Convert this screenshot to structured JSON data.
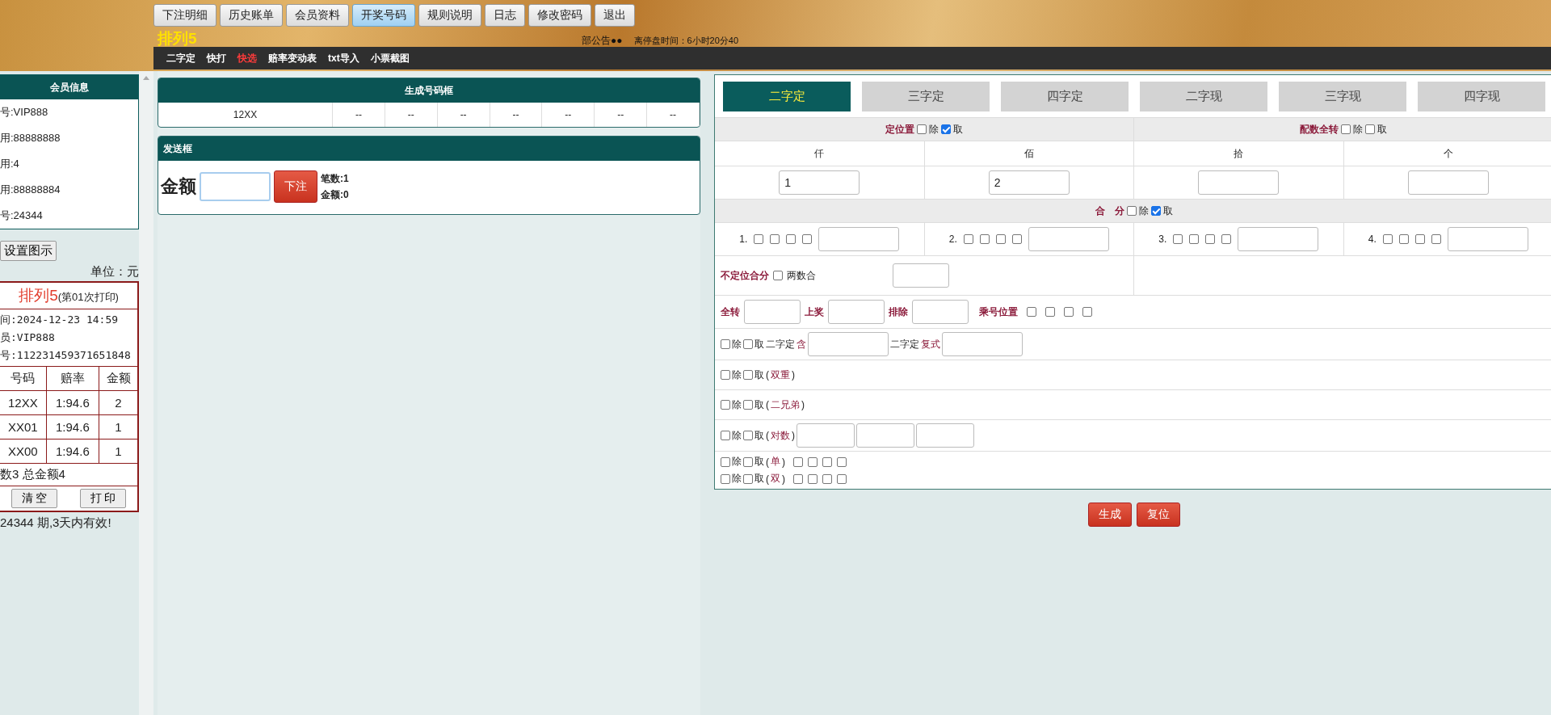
{
  "nav_buttons": [
    {
      "label": "下注明细",
      "selected": false
    },
    {
      "label": "历史账单",
      "selected": false
    },
    {
      "label": "会员资料",
      "selected": false
    },
    {
      "label": "开奖号码",
      "selected": true
    },
    {
      "label": "规则说明",
      "selected": false
    },
    {
      "label": "日志",
      "selected": false
    },
    {
      "label": "修改密码",
      "selected": false
    },
    {
      "label": "退出",
      "selected": false
    }
  ],
  "title": "排列5",
  "notice": "部公告●●",
  "countdown": "离停盘时间：6小时20分40",
  "subnav": [
    {
      "label": "二字定",
      "active": false
    },
    {
      "label": "快打",
      "active": false
    },
    {
      "label": "快选",
      "active": true
    },
    {
      "label": "赔率变动表",
      "active": false
    },
    {
      "label": "txt导入",
      "active": false
    },
    {
      "label": "小票截图",
      "active": false
    }
  ],
  "member_info": {
    "title": "会员信息",
    "lines": [
      "号:VIP888",
      "用:88888888",
      "用:4",
      "用:88888884",
      "号:24344"
    ]
  },
  "settings_button": "设置图示",
  "unit": "单位：元",
  "ticket": {
    "title": "排列5",
    "subtitle": "(第01次打印)",
    "lines": [
      "间:2024-12-23 14:59",
      "员:VIP888",
      "号:112231459371651848"
    ],
    "columns": [
      "号码",
      "赔率",
      "金额"
    ],
    "rows": [
      [
        "12XX",
        "1:94.6",
        "2"
      ],
      [
        "XX01",
        "1:94.6",
        "1"
      ],
      [
        "XX00",
        "1:94.6",
        "1"
      ]
    ],
    "summary": "数3 总金额4",
    "buttons": [
      "清 空",
      "打 印"
    ]
  },
  "validity": "24344 期,3天内有效!",
  "generated": {
    "title": "生成号码框",
    "cells": [
      "12XX",
      "--",
      "--",
      "--",
      "--",
      "--",
      "--",
      "--"
    ]
  },
  "send": {
    "title": "发送框",
    "amount_label": "金额",
    "submit": "下注",
    "count": "笔数:1",
    "total": "金额:0"
  },
  "tabs": [
    {
      "label": "二字定",
      "selected": true
    },
    {
      "label": "三字定",
      "selected": false
    },
    {
      "label": "四字定",
      "selected": false
    },
    {
      "label": "二字现",
      "selected": false
    },
    {
      "label": "三字现",
      "selected": false
    },
    {
      "label": "四字现",
      "selected": false
    }
  ],
  "position_filter": {
    "label": "定位置",
    "options": [
      {
        "label": "除",
        "checked": false
      },
      {
        "label": "取",
        "checked": true
      }
    ]
  },
  "full_rotation": {
    "label": "配数全转",
    "options": [
      {
        "label": "除",
        "checked": false
      },
      {
        "label": "取",
        "checked": false
      }
    ]
  },
  "positions": [
    {
      "label": "仟",
      "value": "1"
    },
    {
      "label": "佰",
      "value": "2"
    },
    {
      "label": "拾"
    },
    {
      "label": "个"
    }
  ],
  "sum_filter": {
    "label": "合　分",
    "options": [
      {
        "label": "除",
        "checked": false
      },
      {
        "label": "取",
        "checked": true
      }
    ]
  },
  "sum_groups": [
    {
      "label": "1.",
      "boxes": [
        false,
        false,
        false,
        false
      ]
    },
    {
      "label": "2.",
      "boxes": [
        false,
        false,
        false,
        false
      ]
    },
    {
      "label": "3.",
      "boxes": [
        false,
        false,
        false,
        false
      ]
    },
    {
      "label": "4.",
      "boxes": [
        false,
        false,
        false,
        false
      ]
    }
  ],
  "unfixed": {
    "label": "不定位合分",
    "option": {
      "label": "两数合",
      "checked": false
    }
  },
  "transfer_row": {
    "fields": [
      "全转",
      "上奖",
      "排除"
    ],
    "multiply_label": "乘号位置",
    "boxes": [
      false,
      false,
      false,
      false
    ]
  },
  "rules": [
    {
      "lines": [
        {
          "exclude": {
            "label": "除",
            "checked": false
          },
          "take": {
            "label": "取",
            "checked": false
          },
          "items": [
            {
              "kind": "text",
              "text": "二字定"
            },
            {
              "kind": "accent",
              "text": "含"
            },
            {
              "kind": "field"
            },
            {
              "kind": "text",
              "text": "二字定"
            },
            {
              "kind": "accent",
              "text": "复式"
            },
            {
              "kind": "field"
            }
          ]
        }
      ]
    },
    {
      "lines": [
        {
          "exclude": {
            "label": "除",
            "checked": false
          },
          "take": {
            "label": "取",
            "checked": false
          },
          "items": [
            {
              "kind": "text",
              "text": "("
            },
            {
              "kind": "accent",
              "text": "双重"
            },
            {
              "kind": "text",
              "text": ")"
            }
          ]
        }
      ]
    },
    {
      "lines": [
        {
          "exclude": {
            "label": "除",
            "checked": false
          },
          "take": {
            "label": "取",
            "checked": false
          },
          "items": [
            {
              "kind": "text",
              "text": "("
            },
            {
              "kind": "accent",
              "text": "二兄弟"
            },
            {
              "kind": "text",
              "text": ")"
            }
          ]
        }
      ]
    },
    {
      "lines": [
        {
          "exclude": {
            "label": "除",
            "checked": false
          },
          "take": {
            "label": "取",
            "checked": false
          },
          "items": [
            {
              "kind": "text",
              "text": "("
            },
            {
              "kind": "accent",
              "text": "对数"
            },
            {
              "kind": "text",
              "text": ")"
            },
            {
              "kind": "field"
            },
            {
              "kind": "field"
            },
            {
              "kind": "field"
            }
          ]
        }
      ]
    },
    {
      "lines": [
        {
          "exclude": {
            "label": "除",
            "checked": false
          },
          "take": {
            "label": "取",
            "checked": false
          },
          "items": [
            {
              "kind": "text",
              "text": "("
            },
            {
              "kind": "accent",
              "text": "单"
            },
            {
              "kind": "text",
              "text": ")"
            },
            {
              "kind": "checkbox",
              "checked": false
            },
            {
              "kind": "checkbox",
              "checked": false
            },
            {
              "kind": "checkbox",
              "checked": false
            },
            {
              "kind": "checkbox",
              "checked": false
            }
          ]
        },
        {
          "exclude": {
            "label": "除",
            "checked": false
          },
          "take": {
            "label": "取",
            "checked": false
          },
          "items": [
            {
              "kind": "text",
              "text": "("
            },
            {
              "kind": "accent",
              "text": "双"
            },
            {
              "kind": "text",
              "text": ")"
            },
            {
              "kind": "checkbox",
              "checked": false
            },
            {
              "kind": "checkbox",
              "checked": false
            },
            {
              "kind": "checkbox",
              "checked": false
            },
            {
              "kind": "checkbox",
              "checked": false
            }
          ]
        }
      ]
    }
  ],
  "actions": [
    "生成",
    "复位"
  ]
}
